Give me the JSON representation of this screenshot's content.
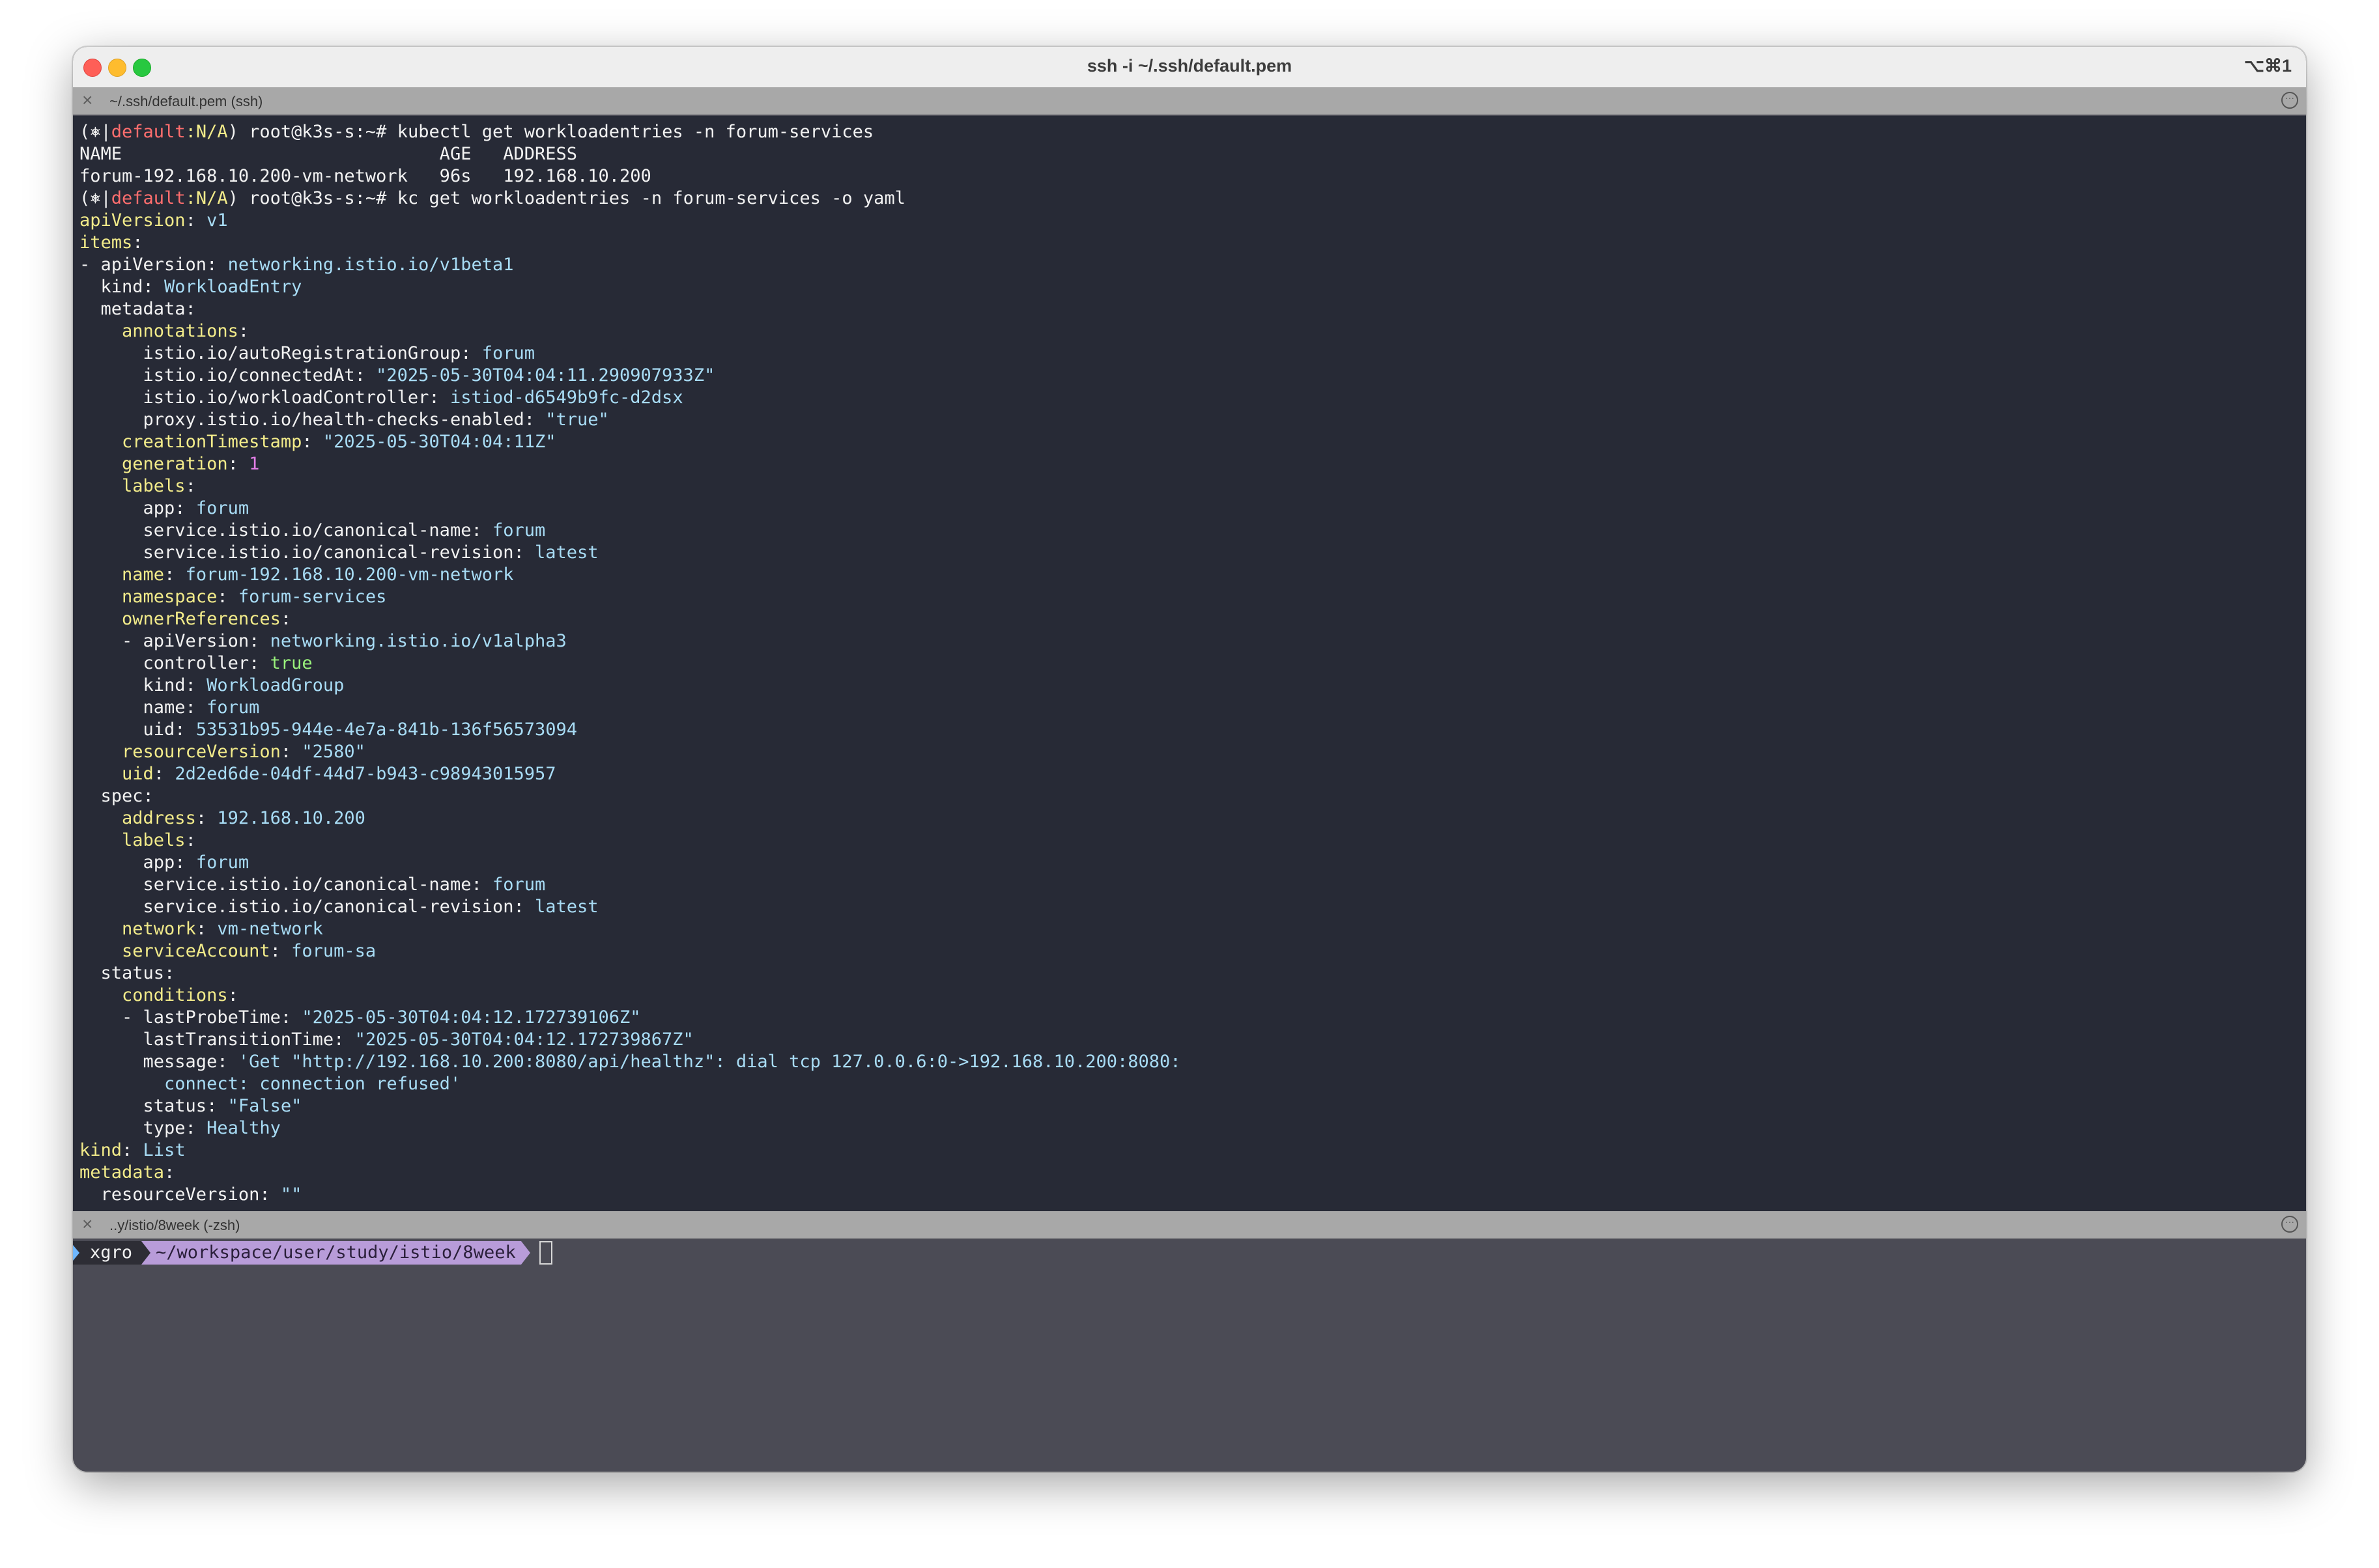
{
  "window": {
    "title": "ssh -i ~/.ssh/default.pem",
    "shortcut": "⌥⌘1"
  },
  "pane_top": {
    "tab_label": "~/.ssh/default.pem (ssh)",
    "lines": [
      [
        [
          "(⎈|",
          ""
        ],
        [
          "default",
          "ctx"
        ],
        [
          ":N/A",
          "nas"
        ],
        [
          ") root@k3s-s:~# kubectl get workloadentries -n forum-services",
          ""
        ]
      ],
      [
        [
          "NAME                              AGE   ADDRESS",
          ""
        ]
      ],
      [
        [
          "forum-192.168.10.200-vm-network   96s   192.168.10.200",
          ""
        ]
      ],
      [
        [
          "(⎈|",
          ""
        ],
        [
          "default",
          "ctx"
        ],
        [
          ":N/A",
          "nas"
        ],
        [
          ") root@k3s-s:~# kc get workloadentries -n forum-services -o yaml",
          ""
        ]
      ],
      [
        [
          "apiVersion",
          "k"
        ],
        [
          ": ",
          ""
        ],
        [
          "v1",
          "s"
        ]
      ],
      [
        [
          "items",
          "k"
        ],
        [
          ":",
          ""
        ]
      ],
      [
        [
          "- apiVersion: ",
          ""
        ],
        [
          "networking.istio.io/v1beta1",
          "s"
        ]
      ],
      [
        [
          "  kind: ",
          ""
        ],
        [
          "WorkloadEntry",
          "s"
        ]
      ],
      [
        [
          "  metadata:",
          ""
        ]
      ],
      [
        [
          "    ",
          ""
        ],
        [
          "annotations",
          "k"
        ],
        [
          ":",
          ""
        ]
      ],
      [
        [
          "      istio.io/autoRegistrationGroup: ",
          ""
        ],
        [
          "forum",
          "s"
        ]
      ],
      [
        [
          "      istio.io/connectedAt: ",
          ""
        ],
        [
          "\"2025-05-30T04:04:11.290907933Z\"",
          "s"
        ]
      ],
      [
        [
          "      istio.io/workloadController: ",
          ""
        ],
        [
          "istiod-d6549b9fc-d2dsx",
          "s"
        ]
      ],
      [
        [
          "      proxy.istio.io/health-checks-enabled: ",
          ""
        ],
        [
          "\"true\"",
          "s"
        ]
      ],
      [
        [
          "    ",
          ""
        ],
        [
          "creationTimestamp",
          "k"
        ],
        [
          ": ",
          ""
        ],
        [
          "\"2025-05-30T04:04:11Z\"",
          "s"
        ]
      ],
      [
        [
          "    ",
          ""
        ],
        [
          "generation",
          "k"
        ],
        [
          ": ",
          ""
        ],
        [
          "1",
          "n"
        ]
      ],
      [
        [
          "    ",
          ""
        ],
        [
          "labels",
          "k"
        ],
        [
          ":",
          ""
        ]
      ],
      [
        [
          "      app: ",
          ""
        ],
        [
          "forum",
          "s"
        ]
      ],
      [
        [
          "      service.istio.io/canonical-name: ",
          ""
        ],
        [
          "forum",
          "s"
        ]
      ],
      [
        [
          "      service.istio.io/canonical-revision: ",
          ""
        ],
        [
          "latest",
          "s"
        ]
      ],
      [
        [
          "    ",
          ""
        ],
        [
          "name",
          "k"
        ],
        [
          ": ",
          ""
        ],
        [
          "forum-192.168.10.200-vm-network",
          "s"
        ]
      ],
      [
        [
          "    ",
          ""
        ],
        [
          "namespace",
          "k"
        ],
        [
          ": ",
          ""
        ],
        [
          "forum-services",
          "s"
        ]
      ],
      [
        [
          "    ",
          ""
        ],
        [
          "ownerReferences",
          "k"
        ],
        [
          ":",
          ""
        ]
      ],
      [
        [
          "    - apiVersion: ",
          ""
        ],
        [
          "networking.istio.io/v1alpha3",
          "s"
        ]
      ],
      [
        [
          "      controller: ",
          ""
        ],
        [
          "true",
          "b"
        ]
      ],
      [
        [
          "      kind: ",
          ""
        ],
        [
          "WorkloadGroup",
          "s"
        ]
      ],
      [
        [
          "      name: ",
          ""
        ],
        [
          "forum",
          "s"
        ]
      ],
      [
        [
          "      uid: ",
          ""
        ],
        [
          "53531b95-944e-4e7a-841b-136f56573094",
          "s"
        ]
      ],
      [
        [
          "    ",
          ""
        ],
        [
          "resourceVersion",
          "k"
        ],
        [
          ": ",
          ""
        ],
        [
          "\"2580\"",
          "s"
        ]
      ],
      [
        [
          "    ",
          ""
        ],
        [
          "uid",
          "k"
        ],
        [
          ": ",
          ""
        ],
        [
          "2d2ed6de-04df-44d7-b943-c98943015957",
          "s"
        ]
      ],
      [
        [
          "  spec:",
          ""
        ]
      ],
      [
        [
          "    ",
          ""
        ],
        [
          "address",
          "k"
        ],
        [
          ": ",
          ""
        ],
        [
          "192.168.10.200",
          "s"
        ]
      ],
      [
        [
          "    ",
          ""
        ],
        [
          "labels",
          "k"
        ],
        [
          ":",
          ""
        ]
      ],
      [
        [
          "      app: ",
          ""
        ],
        [
          "forum",
          "s"
        ]
      ],
      [
        [
          "      service.istio.io/canonical-name: ",
          ""
        ],
        [
          "forum",
          "s"
        ]
      ],
      [
        [
          "      service.istio.io/canonical-revision: ",
          ""
        ],
        [
          "latest",
          "s"
        ]
      ],
      [
        [
          "    ",
          ""
        ],
        [
          "network",
          "k"
        ],
        [
          ": ",
          ""
        ],
        [
          "vm-network",
          "s"
        ]
      ],
      [
        [
          "    ",
          ""
        ],
        [
          "serviceAccount",
          "k"
        ],
        [
          ": ",
          ""
        ],
        [
          "forum-sa",
          "s"
        ]
      ],
      [
        [
          "  status:",
          ""
        ]
      ],
      [
        [
          "    ",
          ""
        ],
        [
          "conditions",
          "k"
        ],
        [
          ":",
          ""
        ]
      ],
      [
        [
          "    - lastProbeTime: ",
          ""
        ],
        [
          "\"2025-05-30T04:04:12.172739106Z\"",
          "s"
        ]
      ],
      [
        [
          "      lastTransitionTime: ",
          ""
        ],
        [
          "\"2025-05-30T04:04:12.172739867Z\"",
          "s"
        ]
      ],
      [
        [
          "      message: ",
          ""
        ],
        [
          "'Get \"http://192.168.10.200:8080/api/healthz\": dial tcp 127.0.0.6:0->192.168.10.200:8080:",
          "s"
        ]
      ],
      [
        [
          "        ",
          ""
        ],
        [
          "connect: connection refused'",
          "s"
        ]
      ],
      [
        [
          "      status: ",
          ""
        ],
        [
          "\"False\"",
          "s"
        ]
      ],
      [
        [
          "      type: ",
          ""
        ],
        [
          "Healthy",
          "s"
        ]
      ],
      [
        [
          "kind",
          "k"
        ],
        [
          ": ",
          ""
        ],
        [
          "List",
          "s"
        ]
      ],
      [
        [
          "metadata",
          "k"
        ],
        [
          ":",
          ""
        ]
      ],
      [
        [
          "  resourceVersion: ",
          ""
        ],
        [
          "\"\"",
          "s"
        ]
      ]
    ]
  },
  "pane_bottom": {
    "tab_label": "..y/istio/8week (-zsh)",
    "prompt_user": "xgro",
    "prompt_path": "~/workspace/user/study/istio/8week"
  },
  "colors": {
    "terminal_bg": "#272a36",
    "yaml_key": "#f2eb8a",
    "yaml_string": "#a8dcf5",
    "yaml_number": "#e27ee6",
    "yaml_bool": "#9af27c",
    "kube_context": "#ff6e6e",
    "prompt_path_bg": "#b89cd9"
  }
}
